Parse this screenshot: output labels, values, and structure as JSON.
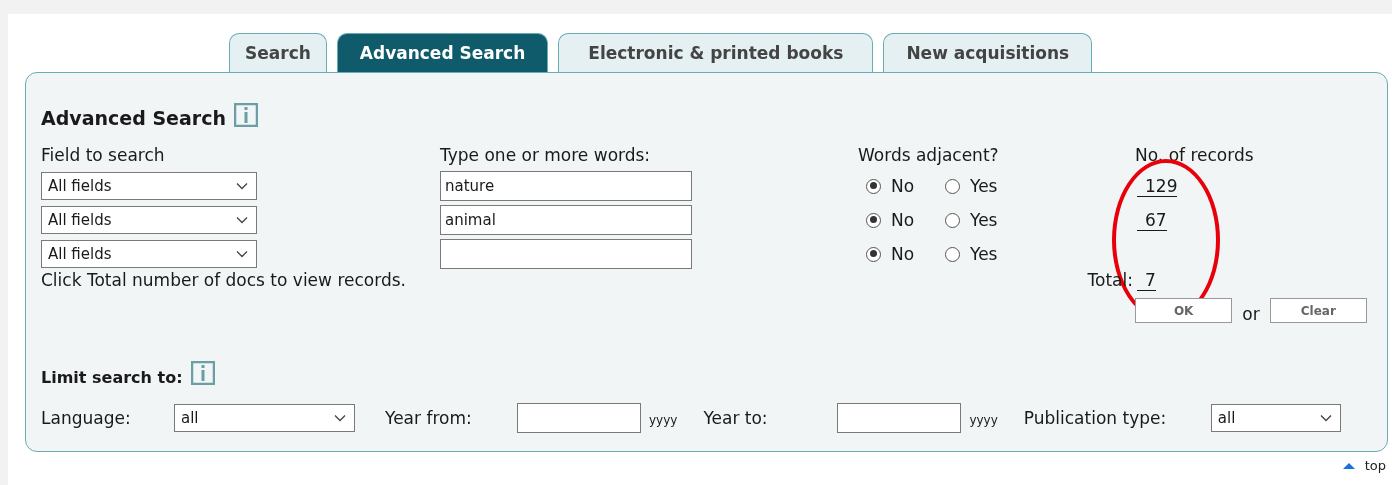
{
  "tabs": [
    {
      "label": "Search",
      "selected": false
    },
    {
      "label": "Advanced Search",
      "selected": true
    },
    {
      "label": "Electronic & printed books",
      "selected": false
    },
    {
      "label": "New acquisitions",
      "selected": false
    }
  ],
  "title": "Advanced Search",
  "columns": [
    "Field to search",
    "Type one or more words:",
    "Words adjacent?",
    "No. of records"
  ],
  "search_rows": [
    {
      "field": "All fields",
      "words": "nature",
      "adjacent": [
        {
          "label": "No",
          "selected": true
        },
        {
          "label": "Yes",
          "selected": false
        }
      ],
      "records": "129"
    },
    {
      "field": "All fields",
      "words": "animal",
      "adjacent": [
        {
          "label": "No",
          "selected": true
        },
        {
          "label": "Yes",
          "selected": false
        }
      ],
      "records": "67"
    },
    {
      "field": "All fields",
      "adjacent": [
        {
          "label": "No",
          "selected": true
        },
        {
          "label": "Yes",
          "selected": false
        }
      ]
    }
  ],
  "hint": "Click Total number of docs to view records.",
  "total_label": "Total:",
  "total_value": "7",
  "buttons": [
    "OK",
    "Clear"
  ],
  "buttons_separator": "or",
  "limit_heading": "Limit search to:",
  "filters": [
    {
      "kind": "select",
      "label": "Language:",
      "value": "all"
    },
    {
      "kind": "year",
      "label": "Year from:",
      "hint": "yyyy"
    },
    {
      "kind": "year",
      "label": "Year to:",
      "hint": "yyyy"
    },
    {
      "kind": "select",
      "label": "Publication type:",
      "value": "all"
    }
  ],
  "top_link": "top",
  "annotation": {
    "kind": "ellipse"
  }
}
